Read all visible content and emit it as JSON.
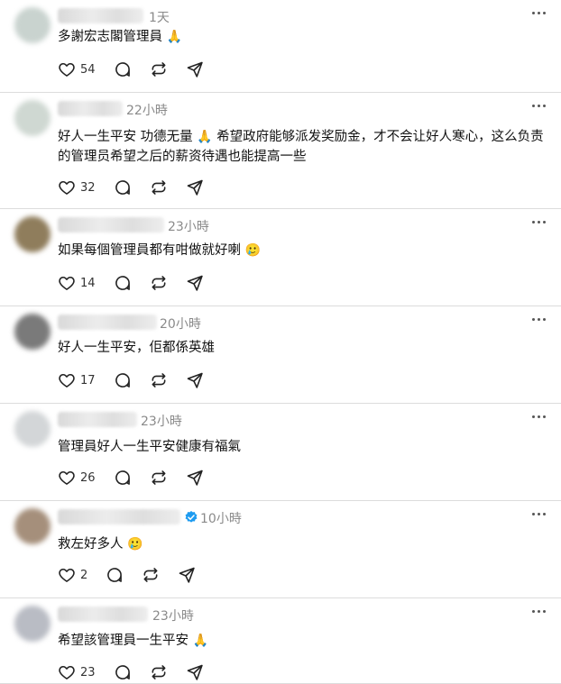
{
  "posts": [
    {
      "time": "1天",
      "text": "多謝宏志閣管理員",
      "emoji": "🙏",
      "likes": "54",
      "verified": false,
      "avatar_color": "#c9d3cf"
    },
    {
      "time": "22小時",
      "text": "好人一生平安 功德无量",
      "emoji": "🙏",
      "text2": " 希望政府能够派发奖励金，才不会让好人寒心，这么负责的管理员希望之后的薪资待遇也能提高一些",
      "likes": "32",
      "verified": false,
      "avatar_color": "#cfd8d2"
    },
    {
      "time": "23小時",
      "text": "如果每個管理員都有咁做就好喇",
      "emoji": "🥲",
      "likes": "14",
      "verified": false,
      "avatar_color": "#8f7d5c"
    },
    {
      "time": "20小時",
      "text": "好人一生平安，佢都係英雄",
      "emoji": "",
      "likes": "17",
      "verified": false,
      "avatar_color": "#7a7a7a"
    },
    {
      "time": "23小時",
      "text": "管理員好人一生平安健康有福氣",
      "emoji": "",
      "likes": "26",
      "verified": false,
      "avatar_color": "#d3d6d8"
    },
    {
      "time": "10小時",
      "text": "救左好多人",
      "emoji": "🥲",
      "likes": "2",
      "verified": true,
      "avatar_color": "#a58f7b"
    },
    {
      "time": "23小時",
      "text": "希望該管理員一生平安",
      "emoji": "🙏",
      "likes": "23",
      "verified": false,
      "avatar_color": "#b9bcc4"
    }
  ],
  "icons": {
    "like": "heart-icon",
    "reply": "comment-icon",
    "repost": "repost-icon",
    "share": "share-icon",
    "more": "more-icon",
    "verified": "verified-badge-icon"
  },
  "colors": {
    "verified": "#1d9bf0",
    "divider": "#dcdcdc",
    "time": "#8a8a8a"
  }
}
